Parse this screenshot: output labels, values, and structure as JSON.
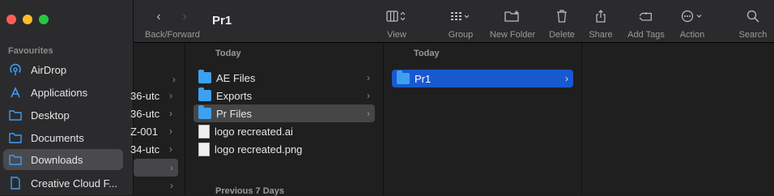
{
  "window": {
    "title": "Pr1",
    "traffic_lights": {
      "close": "#ff5f57",
      "minimize": "#febc2e",
      "zoom": "#28c840"
    }
  },
  "sidebar": {
    "section_title": "Favourites",
    "items": [
      {
        "label": "AirDrop",
        "icon": "airdrop-icon"
      },
      {
        "label": "Applications",
        "icon": "applications-icon"
      },
      {
        "label": "Desktop",
        "icon": "folder-icon"
      },
      {
        "label": "Documents",
        "icon": "folder-icon"
      },
      {
        "label": "Downloads",
        "icon": "download-icon",
        "active": true
      },
      {
        "label": "Creative Cloud F...",
        "icon": "document-icon"
      }
    ]
  },
  "toolbar": {
    "nav_label": "Back/Forward",
    "view_label": "View",
    "group_label": "Group",
    "new_folder_label": "New Folder",
    "delete_label": "Delete",
    "share_label": "Share",
    "add_tags_label": "Add Tags",
    "action_label": "Action",
    "search_label": "Search"
  },
  "columns": {
    "col1": {
      "items": [
        "36-utc",
        "36-utc",
        "Z-001",
        "34-utc"
      ]
    },
    "col2": {
      "section_today": "Today",
      "section_prev": "Previous 7 Days",
      "items": [
        {
          "label": "AE Files",
          "type": "folder"
        },
        {
          "label": "Exports",
          "type": "folder"
        },
        {
          "label": "Pr Files",
          "type": "folder",
          "selected": true
        },
        {
          "label": "logo recreated.ai",
          "type": "file"
        },
        {
          "label": "logo recreated.png",
          "type": "file"
        }
      ]
    },
    "col3": {
      "section_today": "Today",
      "items": [
        {
          "label": "Pr1",
          "type": "folder",
          "selected": true
        }
      ]
    }
  }
}
